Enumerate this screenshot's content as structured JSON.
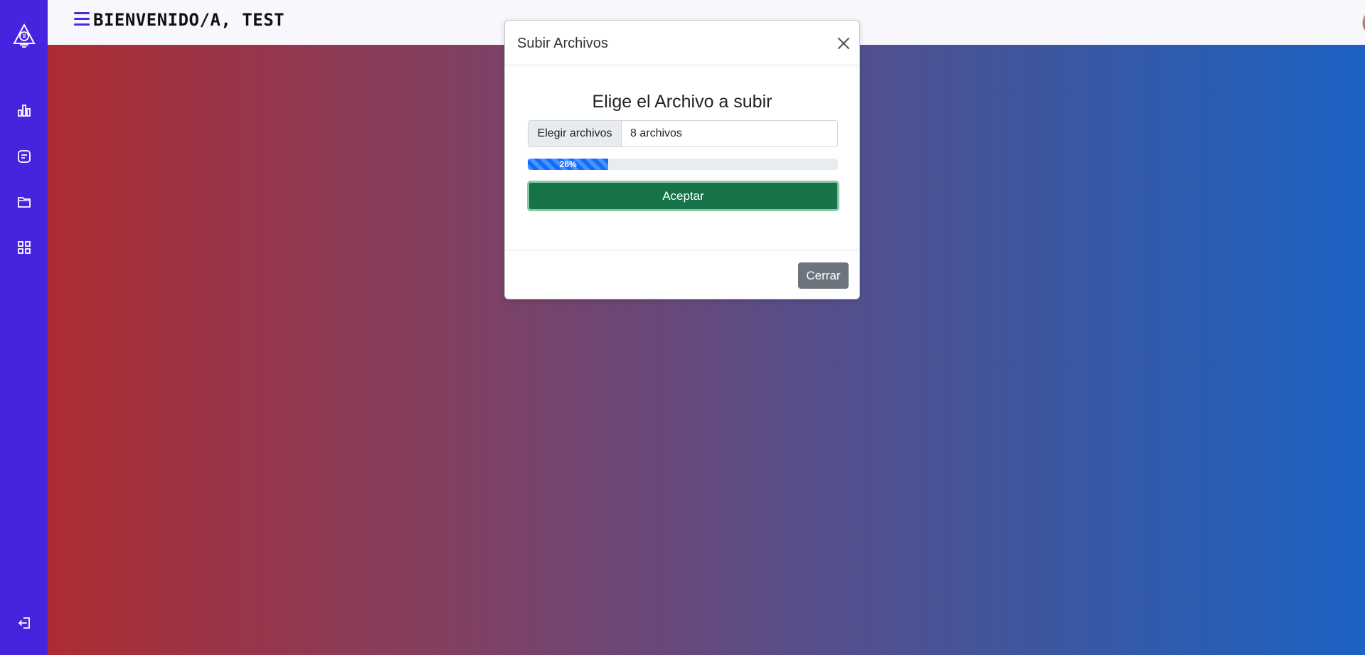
{
  "navbar": {
    "welcome_text": "Bienvenido/a, Test"
  },
  "sidebar": {
    "items": [
      {
        "icon": "logo-icon"
      },
      {
        "icon": "chart-bar-icon"
      },
      {
        "icon": "note-icon"
      },
      {
        "icon": "folder-icon"
      },
      {
        "icon": "grid-icon"
      },
      {
        "icon": "logout-icon"
      }
    ]
  },
  "modal": {
    "title": "Subir Archivos",
    "heading": "Elige el Archivo a subir",
    "file_button_label": "Elegir archivos",
    "file_selection_text": "8 archivos",
    "progress_value": 26,
    "progress_label": "26%",
    "accept_label": "Aceptar",
    "close_label": "Cerrar"
  },
  "colors": {
    "sidebar": "#4623de",
    "accept_button": "#157347",
    "progress_fill": "#0d6efd",
    "close_button": "#6c757d"
  }
}
